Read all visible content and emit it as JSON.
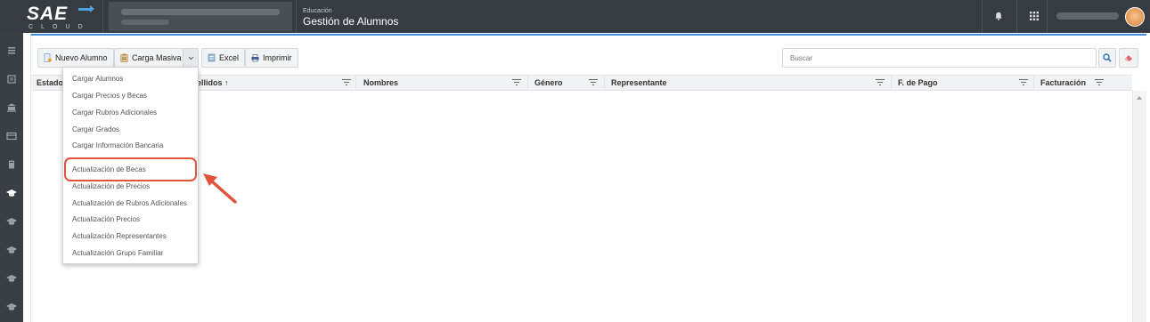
{
  "header": {
    "logo_text": "SAE",
    "logo_sub": "CLOUD",
    "module": "Educación",
    "title": "Gestión de Alumnos",
    "icons": [
      "bell-icon",
      "apps-grid-icon",
      "avatar"
    ]
  },
  "sidebar": {
    "icons": [
      "menu-icon",
      "list-icon",
      "bank-icon",
      "card-icon",
      "book-icon",
      "graduation-cap-icon",
      "graduation-cap-icon",
      "graduation-cap-icon",
      "graduation-cap-icon",
      "graduation-cap-icon"
    ],
    "active_index": 5
  },
  "toolbar": {
    "nuevo_alumno": "Nuevo Alumno",
    "carga_masiva": "Carga Masiva",
    "excel": "Excel",
    "imprimir": "Imprimir",
    "search_placeholder": "Buscar"
  },
  "grid": {
    "columns": [
      "Estado",
      "Apellidos ↑",
      "Nombres",
      "Género",
      "Representante",
      "F. de Pago",
      "Facturación"
    ]
  },
  "menu": {
    "group1": [
      "Cargar Alumnos",
      "Cargar Precios y Becas",
      "Cargar Rubros Adicionales",
      "Cargar Grados",
      "Cargar Información Bancaria"
    ],
    "group2": [
      "Actualización de Becas",
      "Actualización de Precios",
      "Actualización de Rubros Adicionales",
      "Actualización Precios",
      "Actualización Representantes",
      "Actualización Grupo Familiar"
    ]
  },
  "colors": {
    "topbar": "#373b42",
    "accent": "#3c8fd6",
    "highlight": "#e0533c"
  }
}
